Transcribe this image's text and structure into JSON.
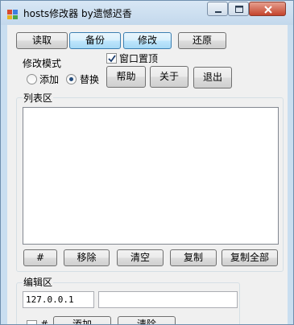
{
  "window": {
    "title": "hosts修改器 by遗憾迟香",
    "icon": "app-icon"
  },
  "toolbar": {
    "read": "读取",
    "backup": "备份",
    "modify": "修改",
    "restore": "还原"
  },
  "mode": {
    "title": "修改模式",
    "add": "添加",
    "replace": "替换",
    "selected": "替换"
  },
  "topmost": {
    "label": "窗口置顶",
    "checked": true
  },
  "actions": {
    "help": "帮助",
    "about": "关于",
    "exit": "退出"
  },
  "list": {
    "title": "列表区",
    "items": []
  },
  "list_actions": {
    "hash": "#",
    "remove": "移除",
    "clear": "清空",
    "copy": "复制",
    "copy_all": "复制全部"
  },
  "edit": {
    "title": "编辑区",
    "ip_value": "127.0.0.1",
    "host_value": "",
    "hash_label": "#",
    "add": "添加",
    "clear": "清除"
  },
  "colors": {
    "accent": "#3c7fb1",
    "close": "#c4442c"
  }
}
